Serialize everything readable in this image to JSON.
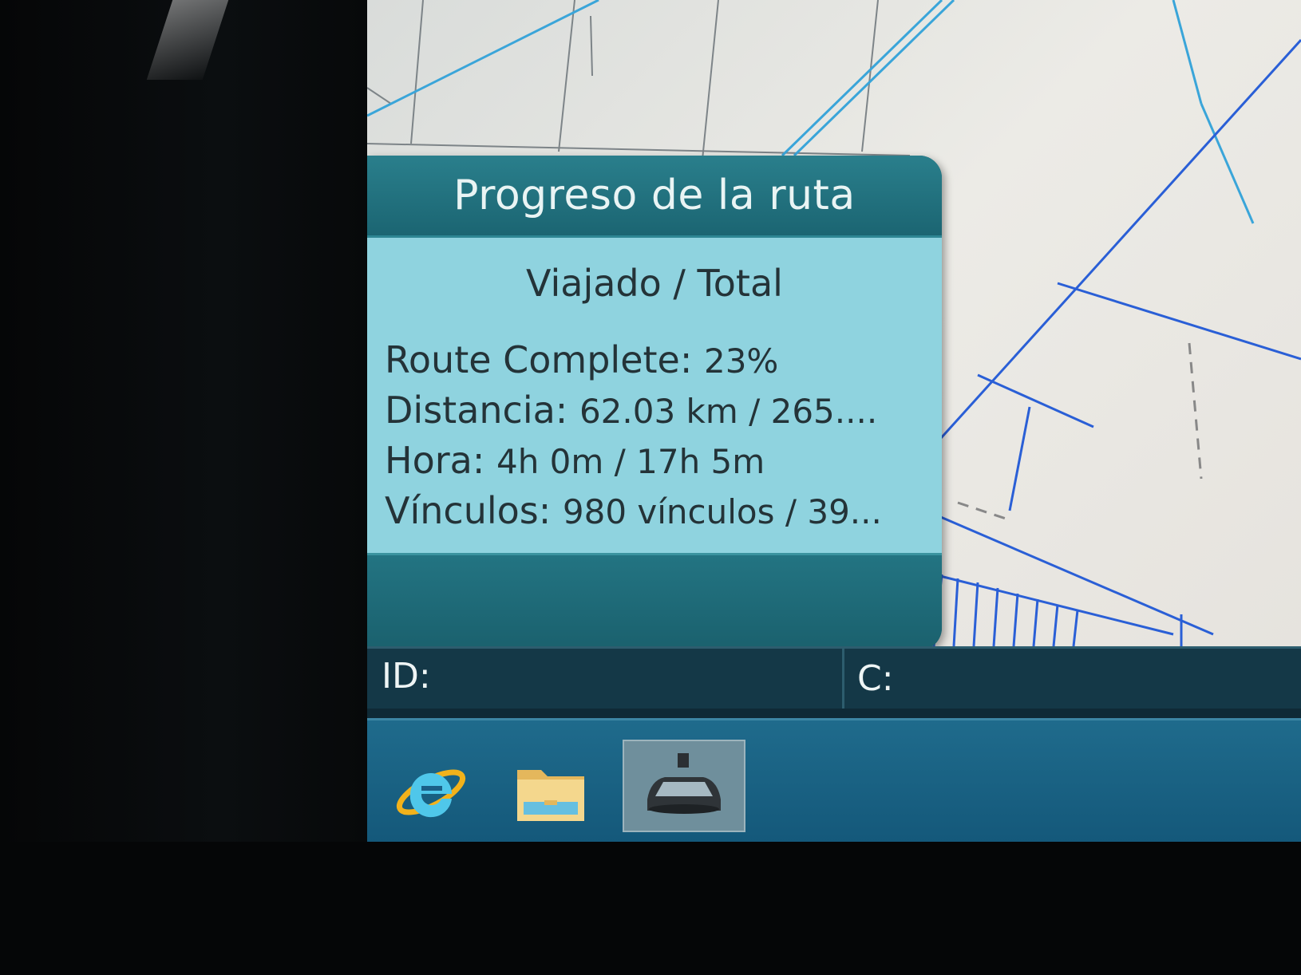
{
  "popup": {
    "title": "Progreso de la ruta",
    "subtitle": "Viajado / Total",
    "rows": [
      {
        "label": "Route Complete:",
        "value": "23%"
      },
      {
        "label": "Distancia:",
        "value": "62.03 km / 265...."
      },
      {
        "label": "Hora:",
        "value": "4h 0m / 17h 5m"
      },
      {
        "label": "Vínculos:",
        "value": "980 vínculos / 39..."
      }
    ]
  },
  "status": {
    "id_label": "ID:",
    "c_label": "C:"
  },
  "taskbar": {
    "icons": [
      "internet-explorer-icon",
      "file-explorer-icon",
      "navigation-vehicle-icon"
    ]
  },
  "colors": {
    "popup_header": "#1b6572",
    "popup_body": "#8fd3df",
    "map_road": "#2a5fd6",
    "map_river": "#3aa5d9",
    "taskbar": "#14587a"
  }
}
